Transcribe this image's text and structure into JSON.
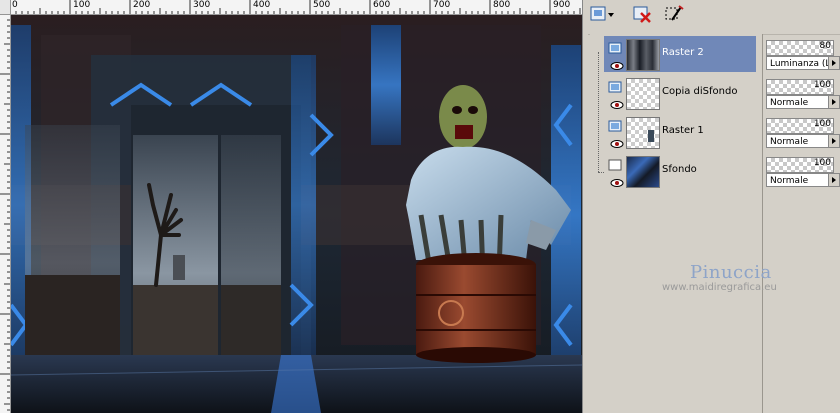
{
  "ruler": {
    "labels": [
      "0",
      "100",
      "200",
      "300",
      "400",
      "500",
      "600",
      "700",
      "800",
      "900"
    ]
  },
  "layers": [
    {
      "name": "Raster 2",
      "selected": true,
      "opacity": "80",
      "blend": "Luminanza (L)",
      "thumb": "dark-texture"
    },
    {
      "name": "Copia diSfondo",
      "selected": false,
      "opacity": "100",
      "blend": "Normale",
      "thumb": "transparent"
    },
    {
      "name": "Raster 1",
      "selected": false,
      "opacity": "100",
      "blend": "Normale",
      "thumb": "transparent-figure"
    },
    {
      "name": "Sfondo",
      "selected": false,
      "opacity": "100",
      "blend": "Normale",
      "thumb": "blue-dark"
    }
  ],
  "toolbar": {
    "icons": [
      "new-layer-dropdown-icon",
      "delete-layer-icon",
      "edit-selection-icon"
    ]
  },
  "watermark": {
    "name": "Pinuccia",
    "url": "www.maidiregrafica.eu"
  },
  "colors": {
    "accent_blue": "#2f7fe0",
    "panel_bg": "#d4d0c8",
    "selected_row": "#7088b8"
  }
}
